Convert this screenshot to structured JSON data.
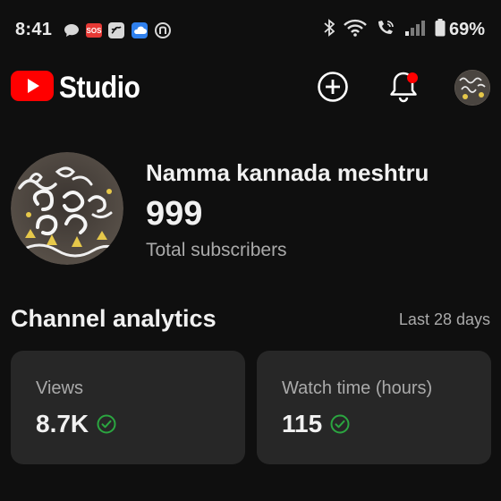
{
  "status_bar": {
    "time": "8:41",
    "sos_label": "SOS",
    "battery_percent": "69%",
    "icons": [
      "chat-bubble-icon",
      "sos-icon",
      "swirl-app-icon",
      "weather-icon",
      "yandex-app-icon",
      "bluetooth-icon",
      "wifi-icon",
      "wifi-calling-icon",
      "signal-icon",
      "battery-icon"
    ]
  },
  "app_bar": {
    "logo_text": "Studio",
    "brand_color": "#ff0000",
    "notification_dot": true
  },
  "channel": {
    "name": "Namma kannada meshtru",
    "subscriber_count": "999",
    "subscriber_label": "Total subscribers"
  },
  "analytics": {
    "title": "Channel analytics",
    "range": "Last 28 days",
    "cards": [
      {
        "label": "Views",
        "value": "8.7K",
        "status_icon": "check-circle-icon",
        "status_color": "#2ba640"
      },
      {
        "label": "Watch time (hours)",
        "value": "115",
        "status_icon": "check-circle-icon",
        "status_color": "#2ba640"
      }
    ]
  }
}
